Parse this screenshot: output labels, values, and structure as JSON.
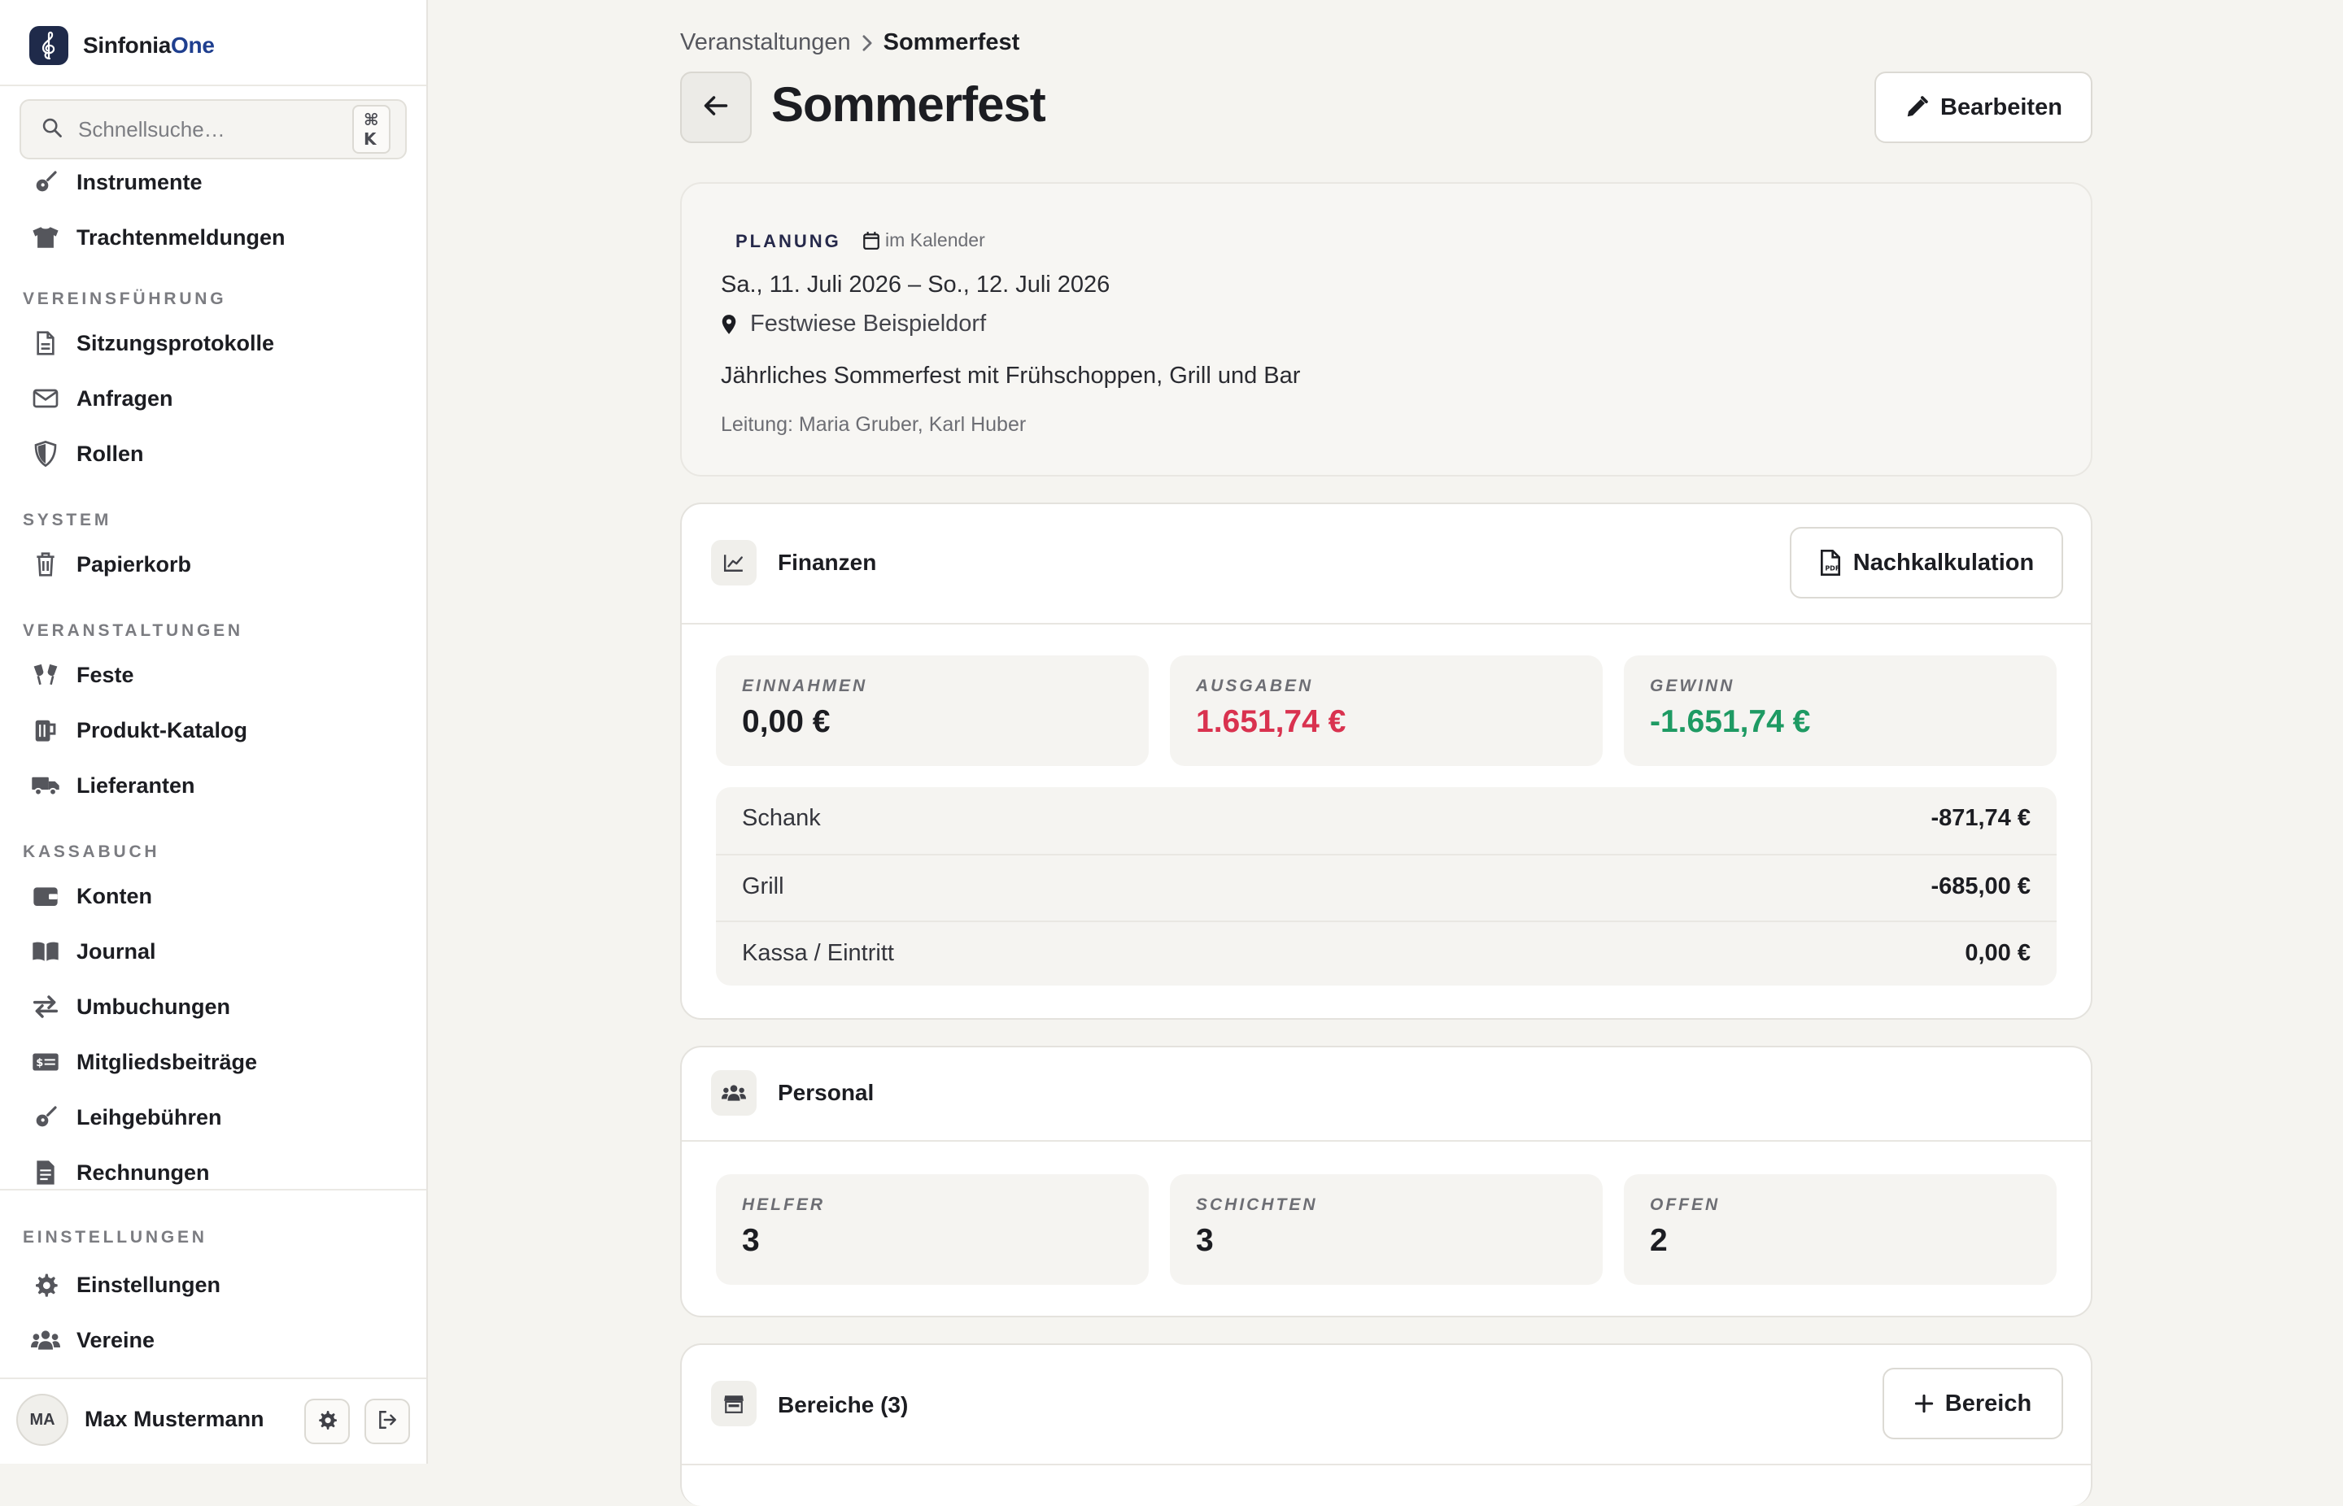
{
  "app": {
    "name_main": "Sinfonia",
    "name_accent": "One"
  },
  "search": {
    "placeholder": "Schnellsuche…",
    "shortcut": "⌘ K"
  },
  "sidebar": {
    "items_top": [
      {
        "label": "Instrumente",
        "icon": "guitar-icon"
      },
      {
        "label": "Trachtenmeldungen",
        "icon": "shirt-icon"
      }
    ],
    "sections": [
      {
        "title": "VEREINSFÜHRUNG",
        "items": [
          {
            "label": "Sitzungsprotokolle",
            "icon": "document-icon"
          },
          {
            "label": "Anfragen",
            "icon": "envelope-icon"
          },
          {
            "label": "Rollen",
            "icon": "shield-icon"
          }
        ]
      },
      {
        "title": "SYSTEM",
        "items": [
          {
            "label": "Papierkorb",
            "icon": "trash-icon"
          }
        ]
      },
      {
        "title": "VERANSTALTUNGEN",
        "items": [
          {
            "label": "Feste",
            "icon": "glasses-cheers-icon"
          },
          {
            "label": "Produkt-Katalog",
            "icon": "mug-icon"
          },
          {
            "label": "Lieferanten",
            "icon": "truck-icon"
          }
        ]
      },
      {
        "title": "KASSABUCH",
        "items": [
          {
            "label": "Konten",
            "icon": "wallet-icon"
          },
          {
            "label": "Journal",
            "icon": "book-icon"
          },
          {
            "label": "Umbuchungen",
            "icon": "transfer-arrows-icon"
          },
          {
            "label": "Mitgliedsbeiträge",
            "icon": "money-card-icon"
          },
          {
            "label": "Leihgebühren",
            "icon": "guitar-icon"
          },
          {
            "label": "Rechnungen",
            "icon": "invoice-icon"
          }
        ]
      }
    ],
    "settings_section": {
      "title": "EINSTELLUNGEN",
      "items": [
        {
          "label": "Einstellungen",
          "icon": "gear-icon"
        },
        {
          "label": "Vereine",
          "icon": "users-icon"
        }
      ]
    },
    "user": {
      "initials": "MA",
      "name": "Max Mustermann"
    }
  },
  "breadcrumb": {
    "parent": "Veranstaltungen",
    "current": "Sommerfest"
  },
  "page": {
    "title": "Sommerfest",
    "edit_label": "Bearbeiten"
  },
  "event": {
    "status": "PLANUNG",
    "calendar": "im Kalender",
    "date_range": "Sa., 11. Juli 2026 – So., 12. Juli 2026",
    "location": "Festwiese Beispieldorf",
    "description": "Jährliches Sommerfest mit Frühschoppen, Grill und Bar",
    "leadership": "Leitung: Maria Gruber, Karl Huber"
  },
  "finances": {
    "title": "Finanzen",
    "action_label": "Nachkalkulation",
    "income_label": "EINNAHMEN",
    "income_value": "0,00 €",
    "expenses_label": "AUSGABEN",
    "expenses_value": "1.651,74 €",
    "profit_label": "GEWINN",
    "profit_value": "-1.651,74 €",
    "breakdown": [
      {
        "label": "Schank",
        "value": "-871,74 €"
      },
      {
        "label": "Grill",
        "value": "-685,00 €"
      },
      {
        "label": "Kassa / Eintritt",
        "value": "0,00 €"
      }
    ],
    "colors": {
      "negative": "#d9324f",
      "positive": "#1e9a63"
    }
  },
  "staff": {
    "title": "Personal",
    "helpers_label": "HELFER",
    "helpers_value": "3",
    "shifts_label": "SCHICHTEN",
    "shifts_value": "3",
    "open_label": "OFFEN",
    "open_value": "2"
  },
  "areas": {
    "title": "Bereiche (3)",
    "add_label": "Bereich"
  }
}
